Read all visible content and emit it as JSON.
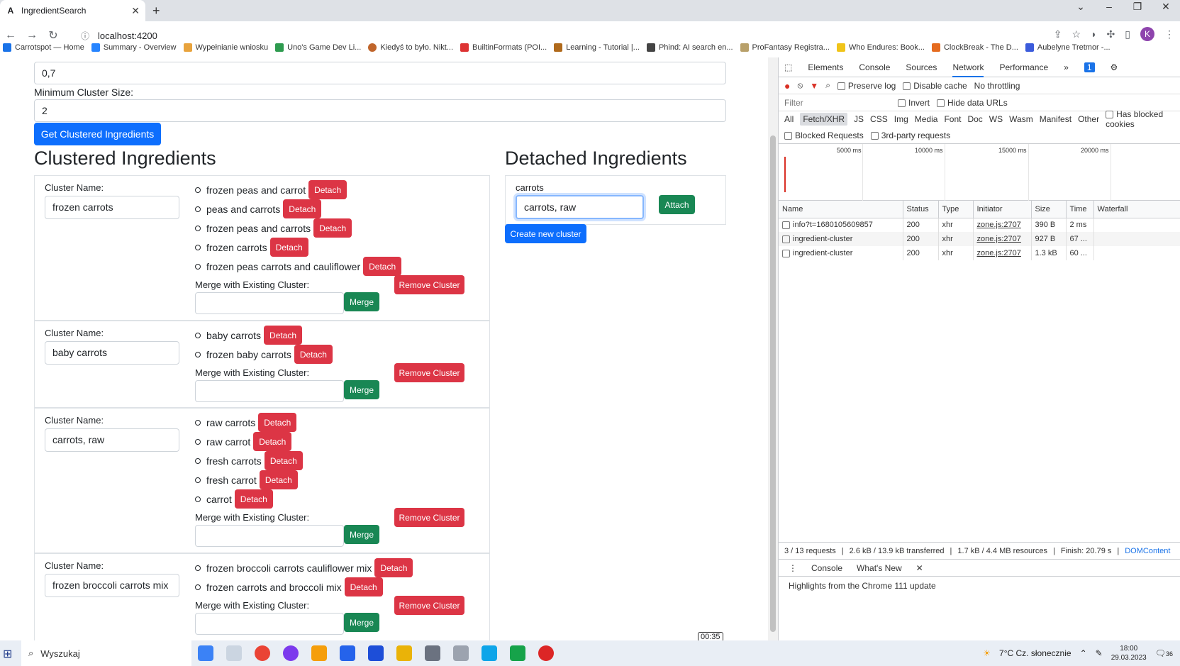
{
  "browser": {
    "tab_title": "IngredientSearch",
    "url": "localhost:4200",
    "bookmarks": [
      "Carrotspot — Home",
      "Summary - Overview",
      "Wypełnianie wniosku",
      "Uno's Game Dev Li...",
      "Kiedyś to było. Nikt...",
      "BuiltinFormats (POI...",
      "Learning - Tutorial |...",
      "Phind: AI search en...",
      "ProFantasy Registra...",
      "Who Endures: Book...",
      "ClockBreak - The D...",
      "Aubelyne Tretmor -..."
    ],
    "avatar_letter": "K"
  },
  "form": {
    "threshold_value": "0,7",
    "min_cluster_label": "Minimum Cluster Size:",
    "min_cluster_value": "2",
    "get_button": "Get Clustered Ingredients"
  },
  "clustered": {
    "heading": "Clustered Ingredients",
    "cluster_name_label": "Cluster Name:",
    "merge_label": "Merge with Existing Cluster:",
    "detach_label": "Detach",
    "merge_button": "Merge",
    "remove_button": "Remove Cluster",
    "clusters": [
      {
        "name": "frozen carrots",
        "items": [
          "frozen peas and carrot",
          "peas and carrots",
          "frozen peas and carrots",
          "frozen carrots",
          "frozen peas carrots and cauliflower"
        ]
      },
      {
        "name": "baby carrots",
        "items": [
          "baby carrots",
          "frozen baby carrots"
        ]
      },
      {
        "name": "carrots, raw",
        "items": [
          "raw carrots",
          "raw carrot",
          "fresh carrots",
          "fresh carrot",
          "carrot"
        ]
      },
      {
        "name": "frozen broccoli carrots mix",
        "items": [
          "frozen broccoli carrots cauliflower mix",
          "frozen carrots and broccoli mix"
        ]
      }
    ]
  },
  "detached": {
    "heading": "Detached Ingredients",
    "item_label": "carrots",
    "input_value": "carrots, raw",
    "attach_button": "Attach",
    "create_button": "Create new cluster"
  },
  "devtools": {
    "tabs": [
      "Elements",
      "Console",
      "Sources",
      "Network",
      "Performance"
    ],
    "badge": "1",
    "preserve_log": "Preserve log",
    "disable_cache": "Disable cache",
    "throttling": "No throttling",
    "filter_placeholder": "Filter",
    "invert": "Invert",
    "hide_data_urls": "Hide data URLs",
    "filter_types": [
      "All",
      "Fetch/XHR",
      "JS",
      "CSS",
      "Img",
      "Media",
      "Font",
      "Doc",
      "WS",
      "Wasm",
      "Manifest",
      "Other"
    ],
    "has_blocked_cookies": "Has blocked cookies",
    "blocked_requests": "Blocked Requests",
    "third_party": "3rd-party requests",
    "timeline_ticks": [
      "5000 ms",
      "10000 ms",
      "15000 ms",
      "20000 ms"
    ],
    "columns": [
      "Name",
      "Status",
      "Type",
      "Initiator",
      "Size",
      "Time",
      "Waterfall"
    ],
    "rows": [
      {
        "name": "info?t=1680105609857",
        "status": "200",
        "type": "xhr",
        "initiator": "zone.js:2707",
        "size": "390 B",
        "time": "2 ms"
      },
      {
        "name": "ingredient-cluster",
        "status": "200",
        "type": "xhr",
        "initiator": "zone.js:2707",
        "size": "927 B",
        "time": "67 ..."
      },
      {
        "name": "ingredient-cluster",
        "status": "200",
        "type": "xhr",
        "initiator": "zone.js:2707",
        "size": "1.3 kB",
        "time": "60 ..."
      }
    ],
    "status_bar": [
      "3 / 13 requests",
      "2.6 kB / 13.9 kB transferred",
      "1.7 kB / 4.4 MB resources",
      "Finish: 20.79 s",
      "DOMContent"
    ],
    "drawer_tabs": [
      "Console",
      "What's New"
    ],
    "drawer_text": "Highlights from the Chrome 111 update"
  },
  "taskbar": {
    "search_label": "Wyszukaj",
    "weather": "7°C  Cz. słonecznie",
    "time": "18:00",
    "date": "29.03.2023",
    "notifications": "36",
    "timer": "00:35"
  }
}
